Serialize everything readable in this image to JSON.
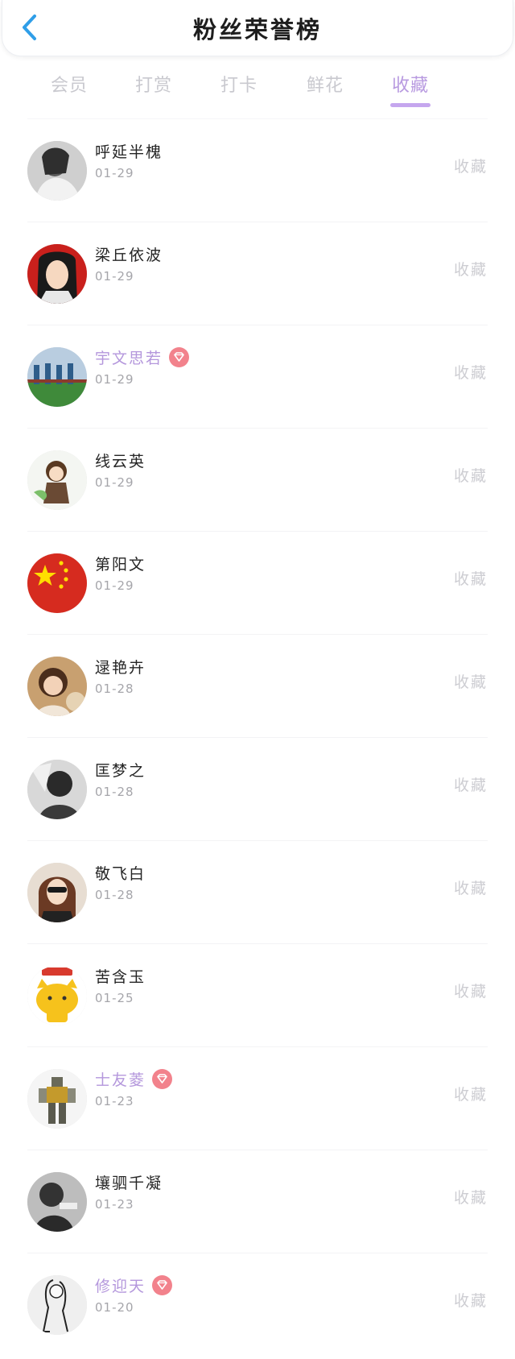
{
  "header": {
    "title": "粉丝荣誉榜",
    "back_icon": "chevron-left-icon",
    "accent_color": "#2f9ee8"
  },
  "tabs": [
    {
      "label": "会员",
      "active": false
    },
    {
      "label": "打赏",
      "active": false
    },
    {
      "label": "打卡",
      "active": false
    },
    {
      "label": "鲜花",
      "active": false
    },
    {
      "label": "收藏",
      "active": true
    }
  ],
  "colors": {
    "active_tab": "#b89ae0",
    "vip_name": "#b497dc",
    "vip_badge": "#f2828c"
  },
  "fans": [
    {
      "name": "呼延半槐",
      "date": "01-29",
      "vip": false,
      "action": "收藏",
      "avatar": "gray-portrait"
    },
    {
      "name": "梁丘依波",
      "date": "01-29",
      "vip": false,
      "action": "收藏",
      "avatar": "red-cartoon-girl"
    },
    {
      "name": "宇文思若",
      "date": "01-29",
      "vip": true,
      "action": "收藏",
      "avatar": "group-photo"
    },
    {
      "name": "线云英",
      "date": "01-29",
      "vip": false,
      "action": "收藏",
      "avatar": "anime-child"
    },
    {
      "name": "第阳文",
      "date": "01-29",
      "vip": false,
      "action": "收藏",
      "avatar": "china-flag"
    },
    {
      "name": "逯艳卉",
      "date": "01-28",
      "vip": false,
      "action": "收藏",
      "avatar": "little-girl"
    },
    {
      "name": "匡梦之",
      "date": "01-28",
      "vip": false,
      "action": "收藏",
      "avatar": "bw-portrait"
    },
    {
      "name": "敬飞白",
      "date": "01-28",
      "vip": false,
      "action": "收藏",
      "avatar": "girl-sunglasses"
    },
    {
      "name": "苦含玉",
      "date": "01-25",
      "vip": false,
      "action": "收藏",
      "avatar": "yellow-cat"
    },
    {
      "name": "士友菱",
      "date": "01-23",
      "vip": true,
      "action": "收藏",
      "avatar": "robot-figure"
    },
    {
      "name": "壤驷千凝",
      "date": "01-23",
      "vip": false,
      "action": "收藏",
      "avatar": "dark-portrait"
    },
    {
      "name": "修迎天",
      "date": "01-20",
      "vip": true,
      "action": "收藏",
      "avatar": "sketch-figure"
    }
  ]
}
